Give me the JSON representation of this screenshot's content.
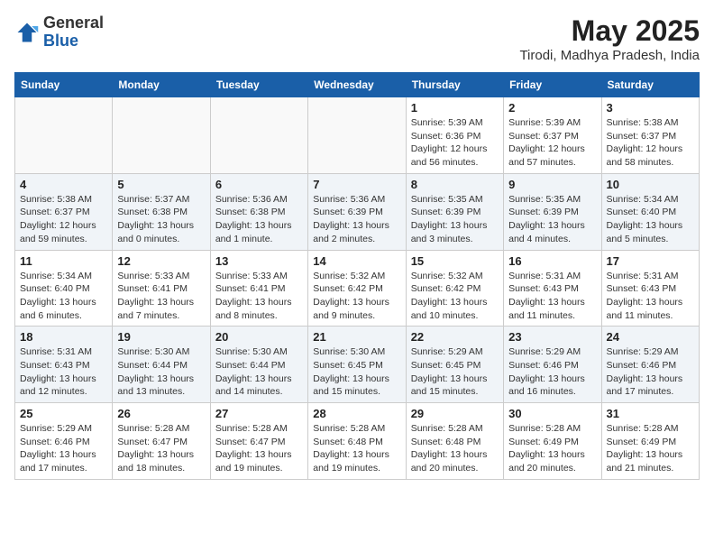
{
  "header": {
    "logo_general": "General",
    "logo_blue": "Blue",
    "month_year": "May 2025",
    "location": "Tirodi, Madhya Pradesh, India"
  },
  "weekdays": [
    "Sunday",
    "Monday",
    "Tuesday",
    "Wednesday",
    "Thursday",
    "Friday",
    "Saturday"
  ],
  "weeks": [
    [
      {
        "day": "",
        "info": ""
      },
      {
        "day": "",
        "info": ""
      },
      {
        "day": "",
        "info": ""
      },
      {
        "day": "",
        "info": ""
      },
      {
        "day": "1",
        "info": "Sunrise: 5:39 AM\nSunset: 6:36 PM\nDaylight: 12 hours\nand 56 minutes."
      },
      {
        "day": "2",
        "info": "Sunrise: 5:39 AM\nSunset: 6:37 PM\nDaylight: 12 hours\nand 57 minutes."
      },
      {
        "day": "3",
        "info": "Sunrise: 5:38 AM\nSunset: 6:37 PM\nDaylight: 12 hours\nand 58 minutes."
      }
    ],
    [
      {
        "day": "4",
        "info": "Sunrise: 5:38 AM\nSunset: 6:37 PM\nDaylight: 12 hours\nand 59 minutes."
      },
      {
        "day": "5",
        "info": "Sunrise: 5:37 AM\nSunset: 6:38 PM\nDaylight: 13 hours\nand 0 minutes."
      },
      {
        "day": "6",
        "info": "Sunrise: 5:36 AM\nSunset: 6:38 PM\nDaylight: 13 hours\nand 1 minute."
      },
      {
        "day": "7",
        "info": "Sunrise: 5:36 AM\nSunset: 6:39 PM\nDaylight: 13 hours\nand 2 minutes."
      },
      {
        "day": "8",
        "info": "Sunrise: 5:35 AM\nSunset: 6:39 PM\nDaylight: 13 hours\nand 3 minutes."
      },
      {
        "day": "9",
        "info": "Sunrise: 5:35 AM\nSunset: 6:39 PM\nDaylight: 13 hours\nand 4 minutes."
      },
      {
        "day": "10",
        "info": "Sunrise: 5:34 AM\nSunset: 6:40 PM\nDaylight: 13 hours\nand 5 minutes."
      }
    ],
    [
      {
        "day": "11",
        "info": "Sunrise: 5:34 AM\nSunset: 6:40 PM\nDaylight: 13 hours\nand 6 minutes."
      },
      {
        "day": "12",
        "info": "Sunrise: 5:33 AM\nSunset: 6:41 PM\nDaylight: 13 hours\nand 7 minutes."
      },
      {
        "day": "13",
        "info": "Sunrise: 5:33 AM\nSunset: 6:41 PM\nDaylight: 13 hours\nand 8 minutes."
      },
      {
        "day": "14",
        "info": "Sunrise: 5:32 AM\nSunset: 6:42 PM\nDaylight: 13 hours\nand 9 minutes."
      },
      {
        "day": "15",
        "info": "Sunrise: 5:32 AM\nSunset: 6:42 PM\nDaylight: 13 hours\nand 10 minutes."
      },
      {
        "day": "16",
        "info": "Sunrise: 5:31 AM\nSunset: 6:43 PM\nDaylight: 13 hours\nand 11 minutes."
      },
      {
        "day": "17",
        "info": "Sunrise: 5:31 AM\nSunset: 6:43 PM\nDaylight: 13 hours\nand 11 minutes."
      }
    ],
    [
      {
        "day": "18",
        "info": "Sunrise: 5:31 AM\nSunset: 6:43 PM\nDaylight: 13 hours\nand 12 minutes."
      },
      {
        "day": "19",
        "info": "Sunrise: 5:30 AM\nSunset: 6:44 PM\nDaylight: 13 hours\nand 13 minutes."
      },
      {
        "day": "20",
        "info": "Sunrise: 5:30 AM\nSunset: 6:44 PM\nDaylight: 13 hours\nand 14 minutes."
      },
      {
        "day": "21",
        "info": "Sunrise: 5:30 AM\nSunset: 6:45 PM\nDaylight: 13 hours\nand 15 minutes."
      },
      {
        "day": "22",
        "info": "Sunrise: 5:29 AM\nSunset: 6:45 PM\nDaylight: 13 hours\nand 15 minutes."
      },
      {
        "day": "23",
        "info": "Sunrise: 5:29 AM\nSunset: 6:46 PM\nDaylight: 13 hours\nand 16 minutes."
      },
      {
        "day": "24",
        "info": "Sunrise: 5:29 AM\nSunset: 6:46 PM\nDaylight: 13 hours\nand 17 minutes."
      }
    ],
    [
      {
        "day": "25",
        "info": "Sunrise: 5:29 AM\nSunset: 6:46 PM\nDaylight: 13 hours\nand 17 minutes."
      },
      {
        "day": "26",
        "info": "Sunrise: 5:28 AM\nSunset: 6:47 PM\nDaylight: 13 hours\nand 18 minutes."
      },
      {
        "day": "27",
        "info": "Sunrise: 5:28 AM\nSunset: 6:47 PM\nDaylight: 13 hours\nand 19 minutes."
      },
      {
        "day": "28",
        "info": "Sunrise: 5:28 AM\nSunset: 6:48 PM\nDaylight: 13 hours\nand 19 minutes."
      },
      {
        "day": "29",
        "info": "Sunrise: 5:28 AM\nSunset: 6:48 PM\nDaylight: 13 hours\nand 20 minutes."
      },
      {
        "day": "30",
        "info": "Sunrise: 5:28 AM\nSunset: 6:49 PM\nDaylight: 13 hours\nand 20 minutes."
      },
      {
        "day": "31",
        "info": "Sunrise: 5:28 AM\nSunset: 6:49 PM\nDaylight: 13 hours\nand 21 minutes."
      }
    ]
  ]
}
